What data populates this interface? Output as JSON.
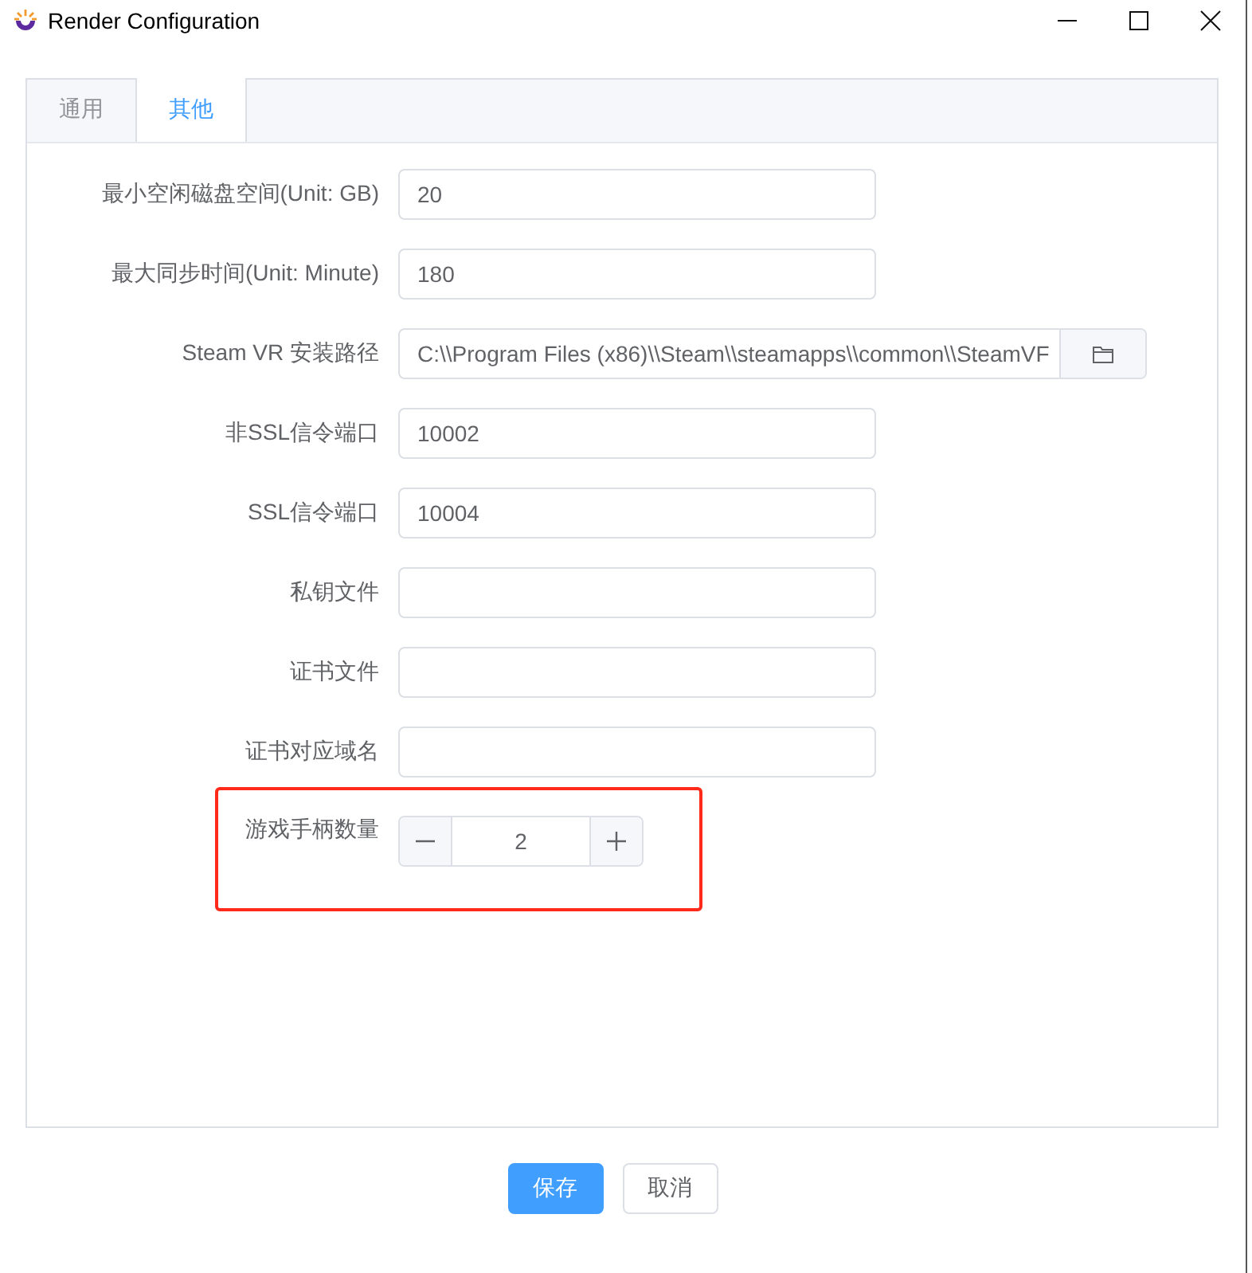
{
  "window": {
    "title": "Render Configuration"
  },
  "tabs": [
    {
      "label": "通用",
      "selected": false
    },
    {
      "label": "其他",
      "selected": true
    }
  ],
  "fields": [
    {
      "kind": "text",
      "label": "最小空闲磁盘空间(Unit: GB)",
      "value": "20",
      "highlighted": false
    },
    {
      "kind": "text",
      "label": "最大同步时间(Unit: Minute)",
      "value": "180",
      "highlighted": false
    },
    {
      "kind": "path",
      "label": "Steam VR 安装路径",
      "value": "C:\\\\Program Files (x86)\\\\Steam\\\\steamapps\\\\common\\\\SteamVF",
      "highlighted": false
    },
    {
      "kind": "text",
      "label": "非SSL信令端口",
      "value": "10002",
      "highlighted": false
    },
    {
      "kind": "text",
      "label": "SSL信令端口",
      "value": "10004",
      "highlighted": false
    },
    {
      "kind": "text",
      "label": "私钥文件",
      "highlighted": false
    },
    {
      "kind": "text",
      "label": "证书文件",
      "highlighted": false
    },
    {
      "kind": "text",
      "label": "证书对应域名",
      "highlighted": false
    },
    {
      "kind": "stepper",
      "label": "游戏手柄数量",
      "value": "2",
      "highlighted": true
    }
  ],
  "buttons": [
    {
      "kind": "primary",
      "label": "保存"
    },
    {
      "kind": "default",
      "label": "取消"
    }
  ]
}
